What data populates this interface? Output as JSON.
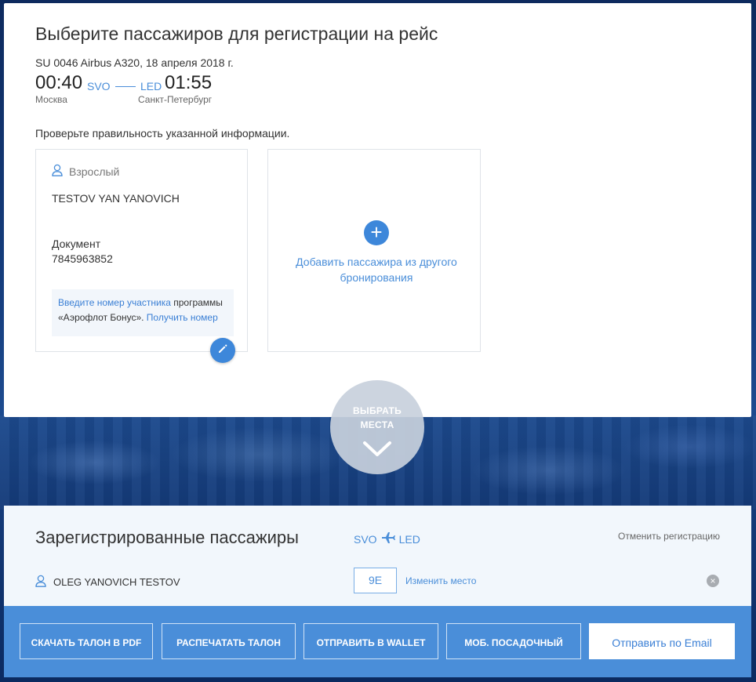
{
  "checkin": {
    "title": "Выберите пассажиров для регистрации на рейс",
    "flight_info": "SU 0046 Airbus A320, 18 апреля 2018 г.",
    "departure": {
      "time": "00:40",
      "code": "SVO",
      "city": "Москва"
    },
    "arrival": {
      "time": "01:55",
      "code": "LED",
      "city": "Санкт-Петербург"
    },
    "check_note": "Проверьте правильность указанной информации."
  },
  "passenger_card": {
    "type": "Взрослый",
    "name": "TESTOV YAN YANOVICH",
    "doc_label": "Документ",
    "doc_number": "7845963852",
    "bonus_link1": "Введите номер участника",
    "bonus_text1": " программы",
    "bonus_text2": "«Аэрофлот Бонус». ",
    "bonus_link2": "Получить номер",
    "icons": {
      "person": "person-icon",
      "edit": "pencil-icon"
    }
  },
  "add_passenger": {
    "plus": "+",
    "text": "Добавить пассажира из другого бронирования"
  },
  "select_seats": {
    "line1": "ВЫБРАТЬ",
    "line2": "МЕСТА",
    "icon": "chevron-down-icon"
  },
  "registered": {
    "title": "Зарегистрированные пассажиры",
    "route_from": "SVO",
    "route_to": "LED",
    "cancel_label": "Отменить регистрацию",
    "passenger_name": "OLEG YANOVICH TESTOV",
    "seat": "9E",
    "change_seat_label": "Изменить место",
    "remove_symbol": "×"
  },
  "actions": {
    "pdf": "СКАЧАТЬ ТАЛОН В PDF",
    "print": "РАСПЕЧАТАТЬ ТАЛОН",
    "wallet": "ОТПРАВИТЬ В WALLET",
    "mobile": "МОБ. ПОСАДОЧНЫЙ",
    "email": "Отправить по Email"
  },
  "colors": {
    "accent": "#4a8ed9",
    "button_blue": "#3d87da",
    "panel": "#f2f7fc"
  }
}
